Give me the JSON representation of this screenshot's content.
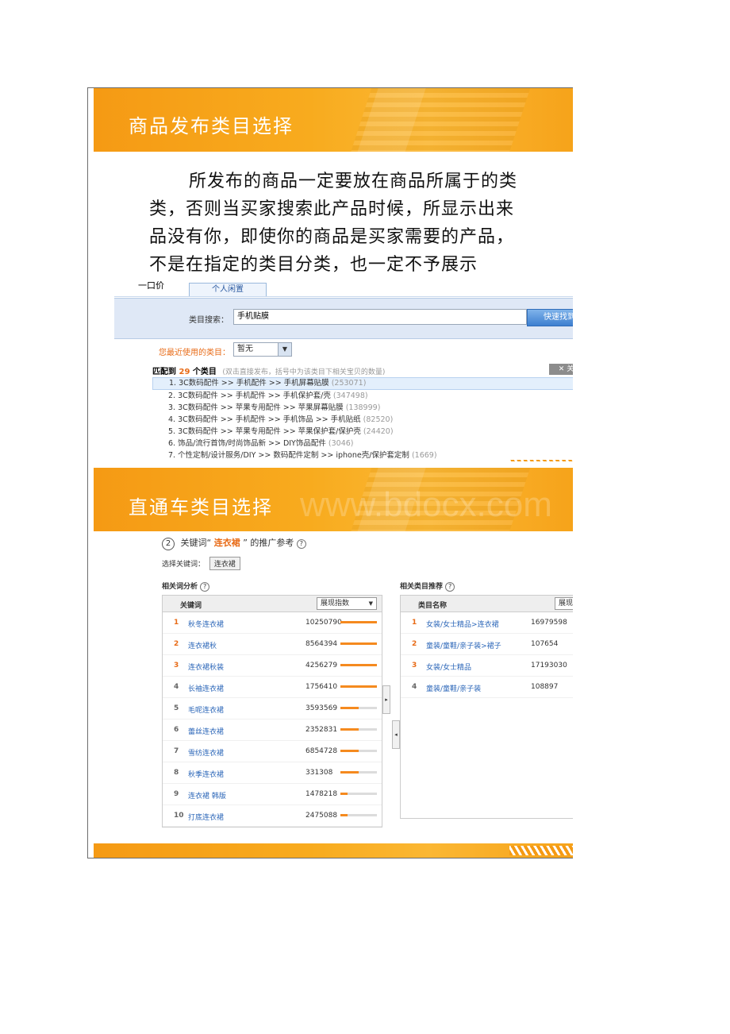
{
  "slide1": {
    "title": "商品发布类目选择",
    "paragraph": [
      "所发布的商品一定要放在商品所属于的类",
      "类，否则当买家搜索此产品时候，所显示出来",
      "品没有你，即使你的商品是买家需要的产品，",
      "不是在指定的类目分类，也一定不予展示"
    ],
    "screenshot": {
      "tab_active": "一口价",
      "tab_other": "个人闲置",
      "search_label": "类目搜索：",
      "search_value": "手机贴膜",
      "search_button": "快速找到",
      "recent_label": "您最近使用的类目：",
      "recent_value": "暂无",
      "match_prefix": "匹配到",
      "match_count": "29",
      "match_suffix": "个类目",
      "match_hint": "(双击直接发布，括号中为该类目下相关宝贝的数量)",
      "close_label": "关闭",
      "rows": [
        {
          "text": "1.  3C数码配件 >> 手机配件 >> 手机屏幕贴膜",
          "count": "(253071)"
        },
        {
          "text": "2.  3C数码配件 >> 手机配件 >> 手机保护套/壳",
          "count": "(347498)"
        },
        {
          "text": "3.  3C数码配件 >> 苹果专用配件 >> 苹果屏幕贴膜",
          "count": "(138999)"
        },
        {
          "text": "4.  3C数码配件 >> 手机配件 >> 手机饰品 >> 手机贴纸",
          "count": "(82520)"
        },
        {
          "text": "5.  3C数码配件 >> 苹果专用配件 >> 苹果保护套/保护壳",
          "count": "(24420)"
        },
        {
          "text": "6.  饰品/流行首饰/时尚饰品新 >> DIY饰品配件",
          "count": "(3046)"
        },
        {
          "text": "7.  个性定制/设计服务/DIY >> 数码配件定制 >> iphone壳/保护套定制",
          "count": "(1669)"
        }
      ]
    }
  },
  "slide2": {
    "title": "直通车类目选择",
    "watermark": "www.bdocx.com",
    "step_number": "2",
    "keyword_prefix": "关键词“",
    "keyword": "连衣裙",
    "keyword_suffix": "” 的推广参考",
    "choose_label": "选择关键词：",
    "choose_chip": "连衣裙",
    "left_section": "相关词分析",
    "right_section": "相关类目推荐",
    "left_header": "关键词",
    "left_sort": "展现指数",
    "right_header": "类目名称",
    "right_sort": "展现",
    "keywords": [
      {
        "rank": "1",
        "name": "秋冬连衣裙",
        "value": "10250790",
        "fill": 1.0
      },
      {
        "rank": "2",
        "name": "连衣裙秋",
        "value": "8564394",
        "fill": 1.0
      },
      {
        "rank": "3",
        "name": "连衣裙秋装",
        "value": "4256279",
        "fill": 1.0
      },
      {
        "rank": "4",
        "name": "长袖连衣裙",
        "value": "1756410",
        "fill": 1.0
      },
      {
        "rank": "5",
        "name": "毛呢连衣裙",
        "value": "3593569",
        "fill": 0.5
      },
      {
        "rank": "6",
        "name": "蕾丝连衣裙",
        "value": "2352831",
        "fill": 0.5
      },
      {
        "rank": "7",
        "name": "雪纺连衣裙",
        "value": "6854728",
        "fill": 0.5
      },
      {
        "rank": "8",
        "name": "秋季连衣裙",
        "value": "331308",
        "fill": 0.5
      },
      {
        "rank": "9",
        "name": "连衣裙 韩版",
        "value": "1478218",
        "fill": 0.2
      },
      {
        "rank": "10",
        "name": "打底连衣裙",
        "value": "2475088",
        "fill": 0.2
      }
    ],
    "categories": [
      {
        "rank": "1",
        "name": "女装/女士精品>连衣裙",
        "value": "16979598"
      },
      {
        "rank": "2",
        "name": "童装/童鞋/亲子装>裙子",
        "value": "107654"
      },
      {
        "rank": "3",
        "name": "女装/女士精品",
        "value": "17193030"
      },
      {
        "rank": "4",
        "name": "童装/童鞋/亲子装",
        "value": "108897"
      }
    ]
  },
  "colors": {
    "banner": "#f8ab1e",
    "accent": "#e86b17",
    "link": "#2b66b8"
  }
}
